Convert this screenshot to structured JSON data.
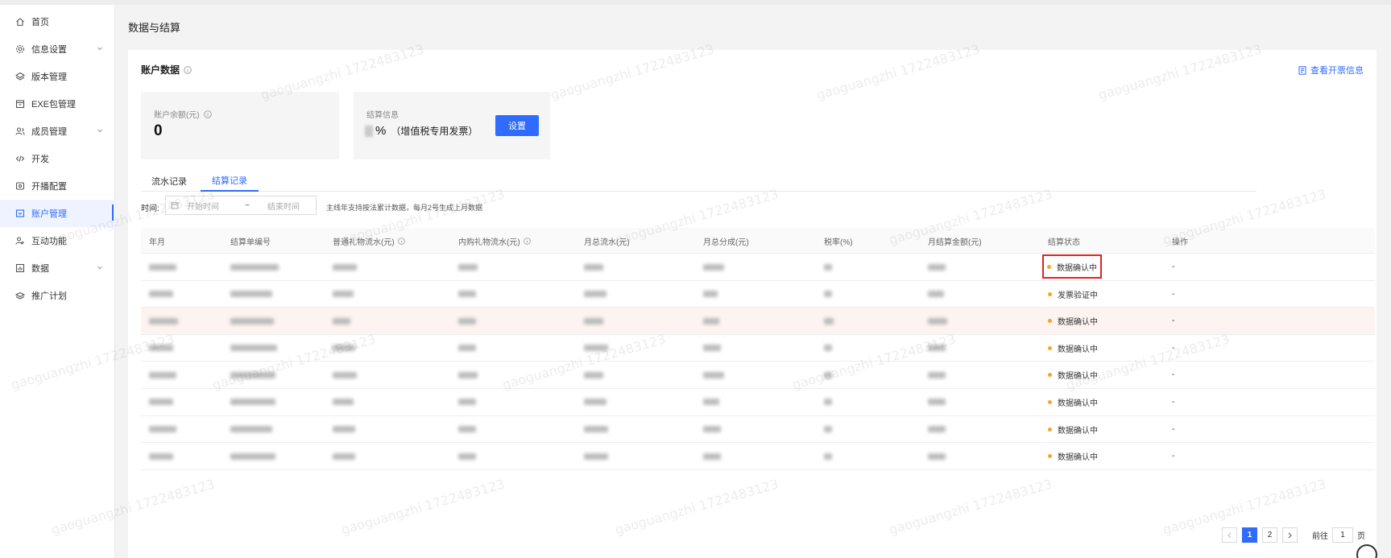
{
  "sidebar": {
    "items": [
      {
        "label": "首页",
        "icon": "home-icon",
        "expandable": false,
        "active": false
      },
      {
        "label": "信息设置",
        "icon": "gear-icon",
        "expandable": true,
        "active": false
      },
      {
        "label": "版本管理",
        "icon": "layers-icon",
        "expandable": false,
        "active": false
      },
      {
        "label": "EXE包管理",
        "icon": "package-icon",
        "expandable": false,
        "active": false
      },
      {
        "label": "成员管理",
        "icon": "users-icon",
        "expandable": true,
        "active": false
      },
      {
        "label": "开发",
        "icon": "code-icon",
        "expandable": false,
        "active": false
      },
      {
        "label": "开播配置",
        "icon": "broadcast-icon",
        "expandable": false,
        "active": false
      },
      {
        "label": "账户管理",
        "icon": "account-icon",
        "expandable": false,
        "active": true
      },
      {
        "label": "互动功能",
        "icon": "interact-icon",
        "expandable": false,
        "active": false
      },
      {
        "label": "数据",
        "icon": "chart-icon",
        "expandable": true,
        "active": false
      },
      {
        "label": "推广计划",
        "icon": "promote-icon",
        "expandable": false,
        "active": false
      }
    ]
  },
  "page": {
    "title": "数据与结算"
  },
  "account": {
    "title": "账户数据",
    "invoice_link": "查看开票信息",
    "balance_label": "账户余额(元)",
    "balance_value": "0",
    "settlement_label": "结算信息",
    "settlement_percent": "%",
    "settlement_note": "（增值税专用发票）",
    "settings_button": "设置"
  },
  "tabs": [
    {
      "label": "流水记录",
      "active": false
    },
    {
      "label": "结算记录",
      "active": true
    }
  ],
  "filter": {
    "label": "时间:",
    "start_placeholder": "开始时间",
    "separator": "~",
    "end_placeholder": "结束时间",
    "hint": "主线年支持按法累计数据，每月2号生成上月数据"
  },
  "table": {
    "columns": [
      "年月",
      "结算单编号",
      "普通礼物流水(元)",
      "内购礼物流水(元)",
      "月总流水(元)",
      "月总分成(元)",
      "税率(%)",
      "月结算金额(元)",
      "结算状态",
      "操作"
    ],
    "rows": [
      {
        "status": "数据确认中",
        "action": "-",
        "highlighted": false,
        "boxed": true
      },
      {
        "status": "发票验证中",
        "action": "-",
        "highlighted": false,
        "boxed": false
      },
      {
        "status": "数据确认中",
        "action": "-",
        "highlighted": true,
        "boxed": false
      },
      {
        "status": "数据确认中",
        "action": "-",
        "highlighted": false,
        "boxed": false
      },
      {
        "status": "数据确认中",
        "action": "-",
        "highlighted": false,
        "boxed": false
      },
      {
        "status": "数据确认中",
        "action": "-",
        "highlighted": false,
        "boxed": false
      },
      {
        "status": "数据确认中",
        "action": "-",
        "highlighted": false,
        "boxed": false
      },
      {
        "status": "数据确认中",
        "action": "-",
        "highlighted": false,
        "boxed": false
      }
    ]
  },
  "pagination": {
    "pages": [
      "1",
      "2"
    ],
    "current": "1",
    "goto_label": "前往",
    "goto_value": "1",
    "goto_suffix": "页"
  },
  "watermark": "gaoguangzhi 1722483123",
  "colors": {
    "accent": "#2f6bff",
    "status_dot": "#f5a623",
    "highlight_row": "#fdf3f1",
    "box_outline": "#e12222"
  }
}
